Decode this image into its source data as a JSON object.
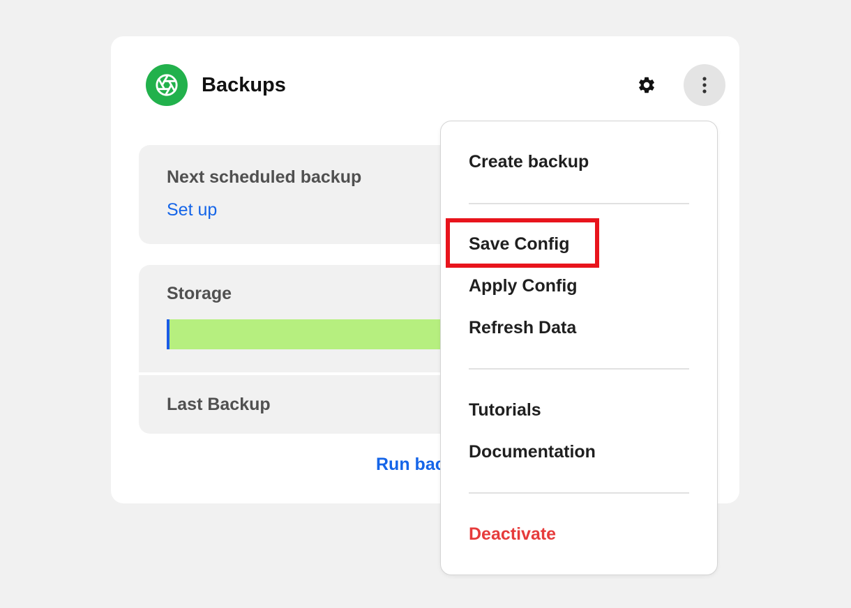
{
  "header": {
    "title": "Backups",
    "logo_icon": "aperture-icon",
    "settings_icon": "gear-icon",
    "more_icon": "more-vertical-icon"
  },
  "next_backup": {
    "label": "Next scheduled backup",
    "link": "Set up"
  },
  "storage": {
    "label": "Storage",
    "last_backup_label": "Last Backup"
  },
  "run_backup": {
    "label": "Run backup"
  },
  "menu": {
    "create_backup": "Create backup",
    "save_config": "Save Config",
    "apply_config": "Apply Config",
    "refresh_data": "Refresh Data",
    "tutorials": "Tutorials",
    "documentation": "Documentation",
    "deactivate": "Deactivate"
  },
  "colors": {
    "brand_green": "#22b14c",
    "link_blue": "#1565e8",
    "danger_red": "#e63b3b",
    "highlight_red": "#e8141c",
    "storage_fill": "#b6ef7f"
  }
}
